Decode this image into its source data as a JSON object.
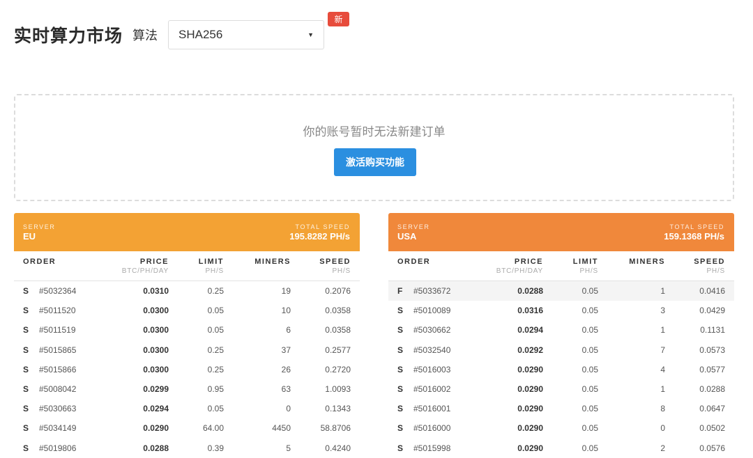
{
  "header": {
    "title": "实时算力市场",
    "algo_label": "算法",
    "algo_selected": "SHA256",
    "new_badge": "新"
  },
  "notice": {
    "message": "你的账号暂时无法新建订单",
    "button_label": "激活购买功能",
    "button_color": "#2b8fe0"
  },
  "columns": {
    "order": "ORDER",
    "price": "PRICE",
    "price_unit": "BTC/PH/DAY",
    "limit": "LIMIT",
    "limit_unit": "PH/S",
    "miners": "MINERS",
    "speed": "SPEED",
    "speed_unit": "PH/S"
  },
  "servers": [
    {
      "label": "SERVER",
      "name": "EU",
      "speed_label": "TOTAL SPEED",
      "total_speed": "195.8282 PH/s",
      "color": "#f3a234",
      "rows": [
        {
          "type": "S",
          "order": "#5032364",
          "price": "0.0310",
          "limit": "0.25",
          "miners": "19",
          "speed": "0.2076"
        },
        {
          "type": "S",
          "order": "#5011520",
          "price": "0.0300",
          "limit": "0.05",
          "miners": "10",
          "speed": "0.0358"
        },
        {
          "type": "S",
          "order": "#5011519",
          "price": "0.0300",
          "limit": "0.05",
          "miners": "6",
          "speed": "0.0358"
        },
        {
          "type": "S",
          "order": "#5015865",
          "price": "0.0300",
          "limit": "0.25",
          "miners": "37",
          "speed": "0.2577"
        },
        {
          "type": "S",
          "order": "#5015866",
          "price": "0.0300",
          "limit": "0.25",
          "miners": "26",
          "speed": "0.2720"
        },
        {
          "type": "S",
          "order": "#5008042",
          "price": "0.0299",
          "limit": "0.95",
          "miners": "63",
          "speed": "1.0093"
        },
        {
          "type": "S",
          "order": "#5030663",
          "price": "0.0294",
          "limit": "0.05",
          "miners": "0",
          "speed": "0.1343"
        },
        {
          "type": "S",
          "order": "#5034149",
          "price": "0.0290",
          "limit": "64.00",
          "miners": "4450",
          "speed": "58.8706"
        },
        {
          "type": "S",
          "order": "#5019806",
          "price": "0.0288",
          "limit": "0.39",
          "miners": "5",
          "speed": "0.4240"
        }
      ]
    },
    {
      "label": "SERVER",
      "name": "USA",
      "speed_label": "TOTAL SPEED",
      "total_speed": "159.1368 PH/s",
      "color": "#f0883b",
      "rows": [
        {
          "type": "F",
          "order": "#5033672",
          "price": "0.0288",
          "limit": "0.05",
          "miners": "1",
          "speed": "0.0416"
        },
        {
          "type": "S",
          "order": "#5010089",
          "price": "0.0316",
          "limit": "0.05",
          "miners": "3",
          "speed": "0.0429"
        },
        {
          "type": "S",
          "order": "#5030662",
          "price": "0.0294",
          "limit": "0.05",
          "miners": "1",
          "speed": "0.1131"
        },
        {
          "type": "S",
          "order": "#5032540",
          "price": "0.0292",
          "limit": "0.05",
          "miners": "7",
          "speed": "0.0573"
        },
        {
          "type": "S",
          "order": "#5016003",
          "price": "0.0290",
          "limit": "0.05",
          "miners": "4",
          "speed": "0.0577"
        },
        {
          "type": "S",
          "order": "#5016002",
          "price": "0.0290",
          "limit": "0.05",
          "miners": "1",
          "speed": "0.0288"
        },
        {
          "type": "S",
          "order": "#5016001",
          "price": "0.0290",
          "limit": "0.05",
          "miners": "8",
          "speed": "0.0647"
        },
        {
          "type": "S",
          "order": "#5016000",
          "price": "0.0290",
          "limit": "0.05",
          "miners": "0",
          "speed": "0.0502"
        },
        {
          "type": "S",
          "order": "#5015998",
          "price": "0.0290",
          "limit": "0.05",
          "miners": "2",
          "speed": "0.0576"
        }
      ]
    }
  ]
}
